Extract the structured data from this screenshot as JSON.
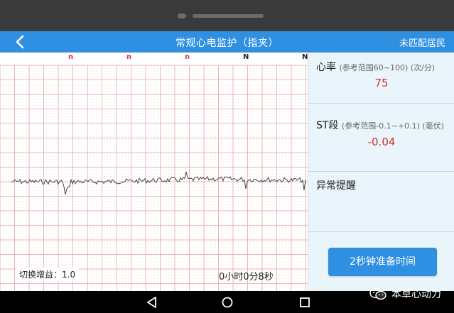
{
  "header": {
    "title": "常规心电监护（指夹）",
    "right_link": "未匹配居民"
  },
  "ecg": {
    "beat_labels": [
      "n",
      "n",
      "n",
      "N",
      "N"
    ],
    "gain_label": "切换增益：1.0",
    "elapsed": "0小时0分8秒",
    "colors": {
      "grid_major": "#e9a3a3",
      "grid_minor": "#f2c6c6",
      "trace": "#333333",
      "abnormal_label": "#d23a3a"
    }
  },
  "panel": {
    "heart_rate": {
      "label": "心率",
      "hint": "(参考范围60~100) (次/分)",
      "value": "75"
    },
    "st_segment": {
      "label": "ST段",
      "hint": "(参考范围-0.1~+0.1) (毫伏)",
      "value": "-0.04"
    },
    "alert_title": "异常提醒",
    "prep_button": "2秒钟准备时间"
  },
  "watermark": "本草心动力",
  "colors": {
    "accent": "#2f8fe0",
    "panel_bg": "#eaf5fb",
    "value_red": "#d03030"
  }
}
